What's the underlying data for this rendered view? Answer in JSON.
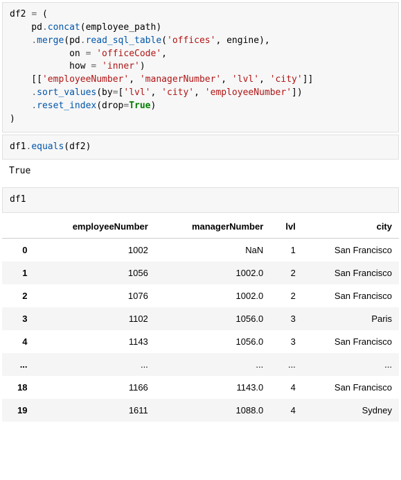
{
  "cell1": {
    "l1_a": "df2 ",
    "l1_b": "=",
    "l1_c": " (",
    "l2_a": "    pd",
    "l2_b": ".",
    "l2_c": "concat",
    "l2_d": "(employee_path)",
    "l3_a": "    ",
    "l3_b": ".",
    "l3_c": "merge",
    "l3_d": "(pd",
    "l3_e": ".",
    "l3_f": "read_sql_table",
    "l3_g": "(",
    "l3_h": "'offices'",
    "l3_i": ", engine),",
    "l4_a": "           on ",
    "l4_b": "=",
    "l4_c": " ",
    "l4_d": "'officeCode'",
    "l4_e": ",",
    "l5_a": "           how ",
    "l5_b": "=",
    "l5_c": " ",
    "l5_d": "'inner'",
    "l5_e": ")",
    "l6_a": "    [[",
    "l6_b": "'employeeNumber'",
    "l6_c": ", ",
    "l6_d": "'managerNumber'",
    "l6_e": ", ",
    "l6_f": "'lvl'",
    "l6_g": ", ",
    "l6_h": "'city'",
    "l6_i": "]]",
    "l7_a": "    ",
    "l7_b": ".",
    "l7_c": "sort_values",
    "l7_d": "(by",
    "l7_e": "=",
    "l7_f": "[",
    "l7_g": "'lvl'",
    "l7_h": ", ",
    "l7_i": "'city'",
    "l7_j": ", ",
    "l7_k": "'employeeNumber'",
    "l7_l": "])",
    "l8_a": "    ",
    "l8_b": ".",
    "l8_c": "reset_index",
    "l8_d": "(drop",
    "l8_e": "=",
    "l8_f": "True",
    "l8_g": ")",
    "l9": ")"
  },
  "cell2": {
    "a": "df1",
    "b": ".",
    "c": "equals",
    "d": "(df2)"
  },
  "out2": "True",
  "cell3": "df1",
  "table": {
    "headers": [
      "employeeNumber",
      "managerNumber",
      "lvl",
      "city"
    ],
    "rows": [
      {
        "idx": "0",
        "c0": "1002",
        "c1": "NaN",
        "c2": "1",
        "c3": "San Francisco"
      },
      {
        "idx": "1",
        "c0": "1056",
        "c1": "1002.0",
        "c2": "2",
        "c3": "San Francisco"
      },
      {
        "idx": "2",
        "c0": "1076",
        "c1": "1002.0",
        "c2": "2",
        "c3": "San Francisco"
      },
      {
        "idx": "3",
        "c0": "1102",
        "c1": "1056.0",
        "c2": "3",
        "c3": "Paris"
      },
      {
        "idx": "4",
        "c0": "1143",
        "c1": "1056.0",
        "c2": "3",
        "c3": "San Francisco"
      },
      {
        "idx": "...",
        "c0": "...",
        "c1": "...",
        "c2": "...",
        "c3": "..."
      },
      {
        "idx": "18",
        "c0": "1166",
        "c1": "1143.0",
        "c2": "4",
        "c3": "San Francisco"
      },
      {
        "idx": "19",
        "c0": "1611",
        "c1": "1088.0",
        "c2": "4",
        "c3": "Sydney"
      }
    ]
  }
}
